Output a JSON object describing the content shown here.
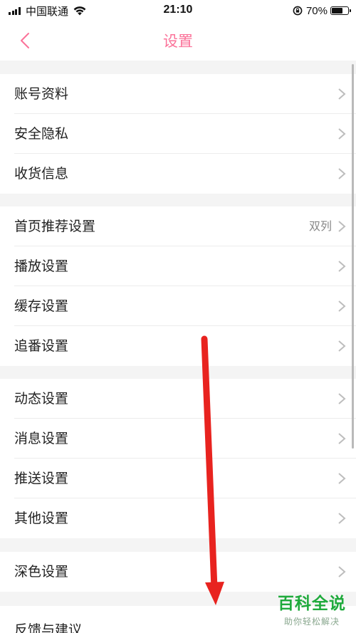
{
  "status_bar": {
    "carrier": "中国联通",
    "time": "21:10",
    "battery_percent": "70%",
    "battery_level": 0.7
  },
  "nav": {
    "title": "设置",
    "back_icon": "chevron-left-icon",
    "accent_color": "#fb7299"
  },
  "groups": [
    {
      "items": [
        {
          "label": "账号资料"
        },
        {
          "label": "安全隐私"
        },
        {
          "label": "收货信息"
        }
      ]
    },
    {
      "items": [
        {
          "label": "首页推荐设置",
          "value": "双列"
        },
        {
          "label": "播放设置"
        },
        {
          "label": "缓存设置"
        },
        {
          "label": "追番设置"
        }
      ]
    },
    {
      "items": [
        {
          "label": "动态设置"
        },
        {
          "label": "消息设置"
        },
        {
          "label": "推送设置"
        },
        {
          "label": "其他设置"
        }
      ]
    },
    {
      "items": [
        {
          "label": "深色设置"
        }
      ]
    },
    {
      "items": [
        {
          "label": "反馈与建议"
        }
      ]
    }
  ],
  "watermark": {
    "title": "百科全说",
    "subtitle": "助你轻松解决"
  },
  "annotation": {
    "color": "#e8231f"
  }
}
